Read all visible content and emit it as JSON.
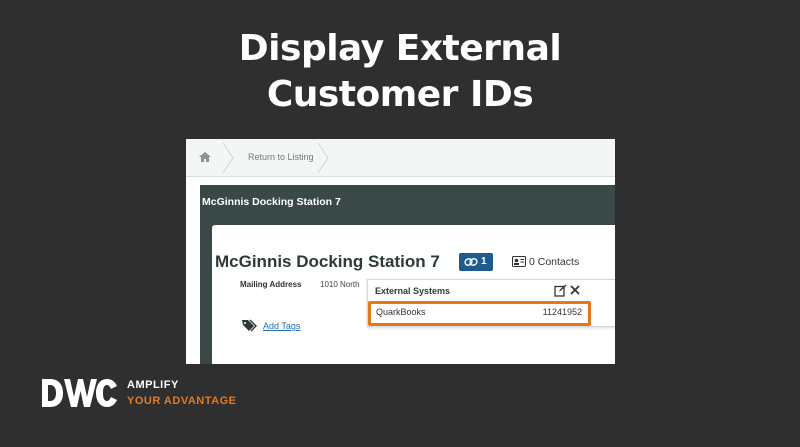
{
  "slide": {
    "title_line1": "Display External",
    "title_line2": "Customer IDs"
  },
  "breadcrumb": {
    "home_icon": "home-icon",
    "return_label": "Return to Listing"
  },
  "record": {
    "header": "McGinnis Docking Station 7",
    "name": "McGinnis Docking Station 7",
    "link_count": "1",
    "contacts_label": "0 Contacts",
    "mailing_label": "Mailing Address",
    "mailing_value": "1010 North",
    "add_tags_label": "Add Tags"
  },
  "external_systems": {
    "title": "External Systems",
    "rows": [
      {
        "system": "QuarkBooks",
        "id": "11241952"
      }
    ]
  },
  "branding": {
    "logo_text": "DWC",
    "tagline_line1": "AMPLIFY",
    "tagline_line2": "YOUR ADVANTAGE",
    "accent_color": "#e07b24"
  },
  "colors": {
    "background": "#2f2f2f",
    "header_band": "#3b4848",
    "badge_blue": "#1f5b8f",
    "highlight_orange": "#e4761e"
  }
}
